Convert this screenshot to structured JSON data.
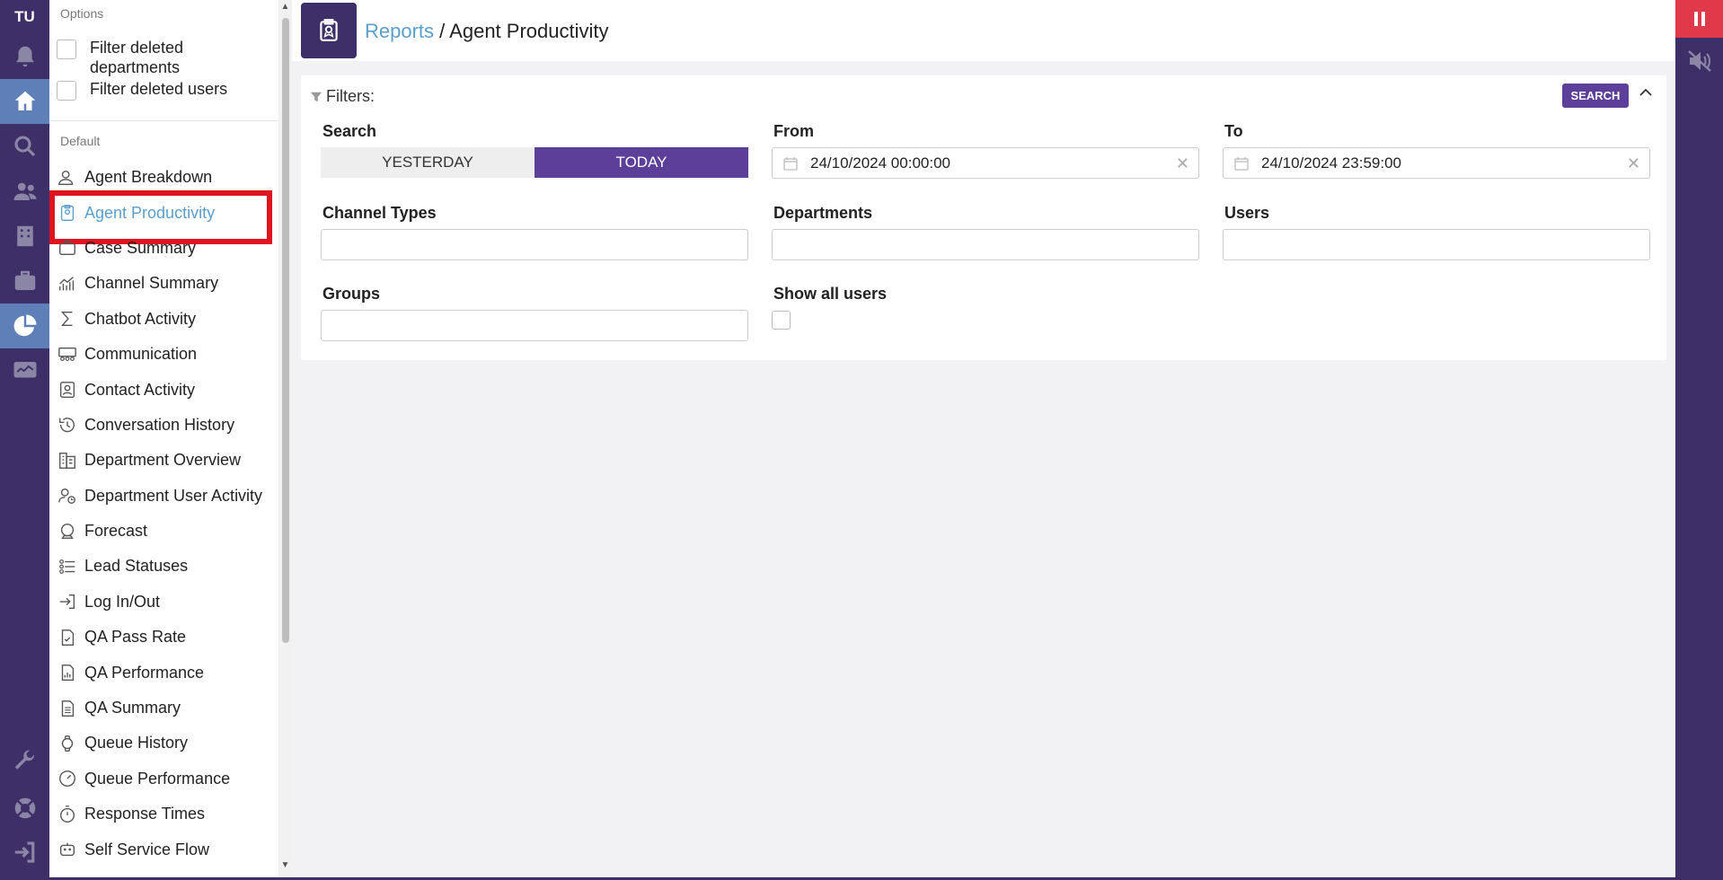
{
  "rail": {
    "logo": "TU",
    "icons": [
      "bell-icon",
      "home-icon",
      "search-icon",
      "users-icon",
      "building-icon",
      "briefcase-icon",
      "pie-chart-icon",
      "monitor-icon",
      "wrench-icon",
      "lifebuoy-icon",
      "logout-icon"
    ]
  },
  "sidebar": {
    "options_caption": "Options",
    "options": [
      {
        "label": "Filter deleted departments",
        "checked": false
      },
      {
        "label": "Filter deleted users",
        "checked": false
      }
    ],
    "default_caption": "Default",
    "items": [
      {
        "label": "Agent Breakdown",
        "icon": "user-details-icon"
      },
      {
        "label": "Agent Productivity",
        "icon": "clipboard-badge-icon",
        "active": true
      },
      {
        "label": "Case Summary",
        "icon": "case-icon"
      },
      {
        "label": "Channel Summary",
        "icon": "chart-line-icon"
      },
      {
        "label": "Chatbot Activity",
        "icon": "sigma-icon"
      },
      {
        "label": "Communication",
        "icon": "people-board-icon"
      },
      {
        "label": "Contact Activity",
        "icon": "contact-card-icon"
      },
      {
        "label": "Conversation History",
        "icon": "history-icon"
      },
      {
        "label": "Department Overview",
        "icon": "building-grid-icon"
      },
      {
        "label": "Department User Activity",
        "icon": "user-clock-icon"
      },
      {
        "label": "Forecast",
        "icon": "crystal-ball-icon"
      },
      {
        "label": "Lead Statuses",
        "icon": "lead-list-icon"
      },
      {
        "label": "Log In/Out",
        "icon": "login-icon"
      },
      {
        "label": "QA Pass Rate",
        "icon": "doc-check-icon"
      },
      {
        "label": "QA Performance",
        "icon": "doc-chart-icon"
      },
      {
        "label": "QA Summary",
        "icon": "doc-lines-icon"
      },
      {
        "label": "Queue History",
        "icon": "watch-icon"
      },
      {
        "label": "Queue Performance",
        "icon": "gauge-icon"
      },
      {
        "label": "Response Times",
        "icon": "stopwatch-icon"
      },
      {
        "label": "Self Service Flow",
        "icon": "robot-icon"
      }
    ]
  },
  "header": {
    "breadcrumb_link": "Reports",
    "breadcrumb_sep": " / ",
    "title": "Agent Productivity"
  },
  "filters": {
    "title": "Filters:",
    "search_button": "SEARCH",
    "search_label": "Search",
    "yesterday": "YESTERDAY",
    "today": "TODAY",
    "from_label": "From",
    "from_value": "24/10/2024 00:00:00",
    "to_label": "To",
    "to_value": "24/10/2024 23:59:00",
    "channel_types_label": "Channel Types",
    "departments_label": "Departments",
    "users_label": "Users",
    "groups_label": "Groups",
    "show_all_users_label": "Show all users",
    "show_all_users_checked": false
  },
  "colors": {
    "brand": "#3d2f67",
    "accent": "#5b3f98",
    "link": "#5a9fcc",
    "highlight": "#e0141e"
  }
}
